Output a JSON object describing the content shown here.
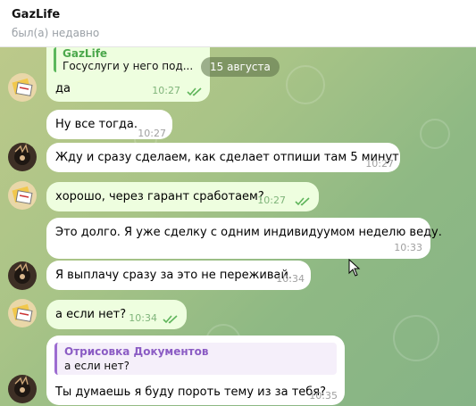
{
  "header": {
    "title": "GazLife",
    "status": "был(а) недавно"
  },
  "date_separator": "15 августа",
  "messages": [
    {
      "reply": {
        "name": "GazLife",
        "text": "Госуслуги у него под..."
      },
      "text": "да",
      "time": "10:27",
      "read": true
    },
    {
      "text": "Ну все тогда.",
      "time": "10:27"
    },
    {
      "text": "Жду и сразу сделаем, как сделает отпиши там 5 минут",
      "time": "10:27"
    },
    {
      "text": "хорошо, через гарант сработаем?",
      "time": "10:27",
      "read": true
    },
    {
      "text": "Это долго. Я уже сделку с одним индивидуумом неделю веду.",
      "time": "10:33"
    },
    {
      "text": "Я выплачу сразу за это не переживай.",
      "time": "10:34"
    },
    {
      "text": "а если нет?",
      "time": "10:34",
      "read": true
    },
    {
      "reply": {
        "name": "Отрисовка Документов",
        "text": "а если нет?"
      },
      "text": "Ты думаешь я буду пороть тему из за тебя?",
      "time": "10:35"
    }
  ],
  "colors": {
    "outgoing_bubble": "#eefedf",
    "incoming_bubble": "#ffffff",
    "read_ticks": "#5fb55b",
    "reply_accent_green": "#4ca84c",
    "reply_accent_purple": "#8b5cc4"
  },
  "icons": {
    "read_receipt": "double-check-icon",
    "cursor": "mouse-pointer-icon"
  }
}
